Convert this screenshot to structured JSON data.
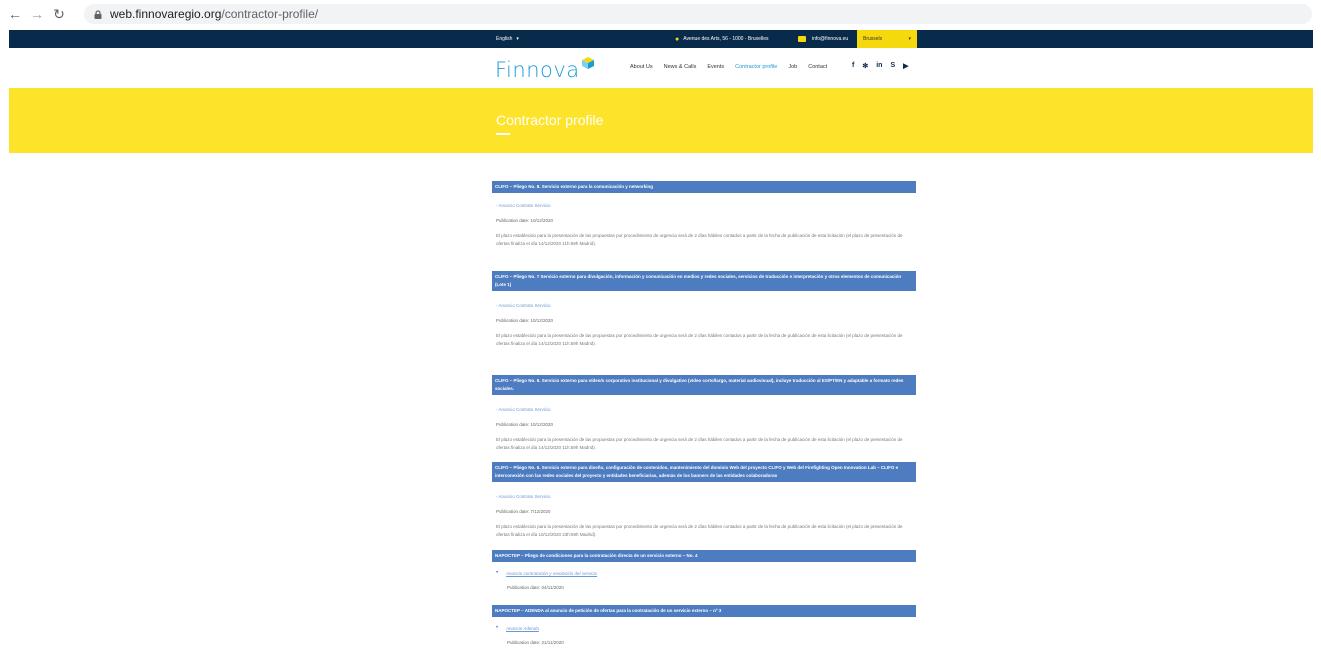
{
  "browser": {
    "url_host": "web.finnovaregio.org",
    "url_path": "/contractor-profile/"
  },
  "topbar": {
    "language": "English",
    "address": "Avenue des Arts, 56 - 1000 - Bruxelles",
    "email": "info@finnova.eu",
    "city": "Brussels"
  },
  "header": {
    "logo": "Finnova",
    "nav": [
      "About Us",
      "News & Calls",
      "Events",
      "Contractor profile",
      "Job",
      "Contact"
    ],
    "social_icons": [
      "facebook-icon",
      "twitter-icon",
      "linkedin-icon",
      "skype-icon",
      "youtube-icon"
    ]
  },
  "banner": {
    "title": "Contractor profile"
  },
  "colors": {
    "accent": "#1b9bd7",
    "banner": "#fde329",
    "topbar": "#082a4b",
    "section_bar": "#4e7cc1"
  },
  "entries": [
    {
      "title": "CLIFO – Pliego No. 8. Servicio externo para la comunicación y networking",
      "link": "- Anuncio Contrato Servicio",
      "date": "Publication date: 10/12/2020",
      "desc": "El plazo establecido para la presentación de las propuestas por procedimiento de urgencia será de 2 días hábiles contados a partir de la fecha de publicación de esta licitación (el plazo de presentación de ofertas finaliza el día 14/12/2020 11h:59h Madrid)."
    },
    {
      "title": "CLIFO – Pliego No. 7 Servicio externo para divulgación, información y comunicación en medios y redes sociales, servicios de traducción e interpretación y otros elementos de comunicación (Lote 1)",
      "link": "- Anuncio Contrato Servicio",
      "date": "Publication date: 10/12/2020",
      "desc": "El plazo establecido para la presentación de las propuestas por procedimiento de urgencia será de 2 días hábiles contados a partir de la fecha de publicación de esta licitación (el plazo de presentación de ofertas finaliza el día 14/12/2020 11h:59h Madrid)."
    },
    {
      "title": "CLIFO – Pliego No. 6. Servicio externo para vídeo/s corporativo institucional y divulgativo (vídeo corto/largo, material audiovisual), incluye traducción al ES/PT/EN y adaptable a formato redes sociales.",
      "link": "- Anuncio Contrato Servicio",
      "date": "Publication date: 10/12/2020",
      "desc": "El plazo establecido para la presentación de las propuestas por procedimiento de urgencia será de 2 días hábiles contados a partir de la fecha de publicación de esta licitación (el plazo de presentación de ofertas finaliza el día 14/12/2020 11h:59h Madrid)."
    },
    {
      "title": "CLIFO – Pliego No. 5. Servicio externo para diseño, configuración de contenidos, mantenimiento del dominio Web del proyecto CLIFO y Web del Firefighting Open Innovation Lab – CLIFO e interconexión con las redes sociales del proyecto y entidades beneficiarias, además de los banners de las entidades colaboradoras",
      "link": "- Anuncio Contrato Servicio",
      "date": "Publication date: 7/12/2020",
      "desc": "El plazo establecido para la presentación de las propuestas por procedimiento de urgencia será de 2 días hábiles contados a partir de la fecha de publicación de esta licitación (el plazo de presentación de ofertas finaliza el día 10/12/2020 23h:59h Madrid)."
    }
  ],
  "bullet_entries": [
    {
      "title": "NAPOCTEP – Pliego de condiciones para la contratación directa de un servicio externo – No. 4",
      "link": "Anuncio contratación y resolución del servicio",
      "date": "Publication date: 04/11/2020"
    },
    {
      "title": "NAPOCTEP – ADENDA al anuncio de petición de ofertas para la contratación de un servicio externo – nº 3",
      "link": "Anuncio Adenda",
      "date": "Publication date: 21/11/2020"
    }
  ]
}
